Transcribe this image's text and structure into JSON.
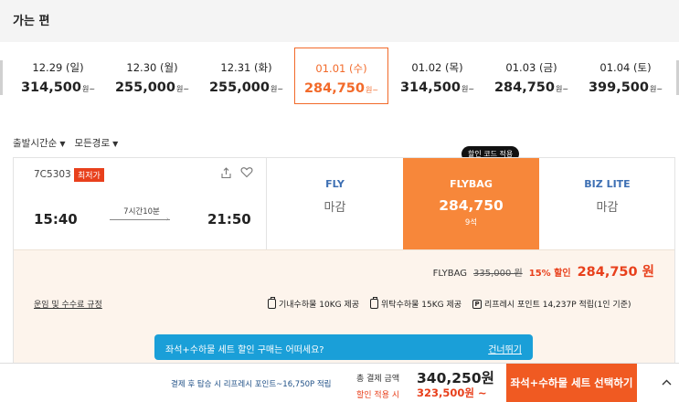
{
  "section": {
    "title": "가는 편"
  },
  "dates": [
    {
      "date": "12.29 (일)",
      "price": "314,500",
      "unit": "원~"
    },
    {
      "date": "12.30 (월)",
      "price": "255,000",
      "unit": "원~"
    },
    {
      "date": "12.31 (화)",
      "price": "255,000",
      "unit": "원~"
    },
    {
      "date": "01.01 (수)",
      "price": "284,750",
      "unit": "원~",
      "selected": true
    },
    {
      "date": "01.02 (목)",
      "price": "314,500",
      "unit": "원~"
    },
    {
      "date": "01.03 (금)",
      "price": "284,750",
      "unit": "원~"
    },
    {
      "date": "01.04 (토)",
      "price": "399,500",
      "unit": "원~"
    }
  ],
  "filters": {
    "sort": "출발시간순",
    "route": "모든경로"
  },
  "flight": {
    "number": "7C5303",
    "badge": "최저가",
    "departure": "15:40",
    "arrival": "21:50",
    "duration": "7시간10분"
  },
  "fares": {
    "fly": {
      "name": "FLY",
      "status": "마감"
    },
    "flybag": {
      "name": "FLYBAG",
      "price": "284,750",
      "seats": "9석"
    },
    "bizlite": {
      "name": "BIZ LITE",
      "status": "마감"
    }
  },
  "promo_bubble": "할인 코드 적용",
  "price_detail": {
    "fare_name": "FLYBAG",
    "original": "335,000 원",
    "discount": "15% 할인",
    "final": "284,750 원"
  },
  "rules_link": "운임 및 수수료 규정",
  "benefits": {
    "carry_on": "기내수하물 10KG 제공",
    "checked": "위탁수하물 15KG 제공",
    "points_icon": "P",
    "points": "리프레시 포인트 14,237P 적립(1인 기준)"
  },
  "banner": {
    "text": "좌석+수하물 세트 할인 구매는 어떠세요?",
    "skip": "건너뛰기"
  },
  "footer": {
    "note": "결제 후 탑승 시 리프레시 포인트~16,750P 적립",
    "total_label": "총 결제 금액",
    "total": "340,250원",
    "discount_label": "할인 적용 시",
    "discount_price": "323,500원 ~",
    "cta": "좌석+수하물 세트 선택하기",
    "collapse_icon": "chevron-up-icon"
  },
  "colors": {
    "accent": "#f26a2a",
    "fare_selected": "#f7873a",
    "banner": "#1a9fd8",
    "discount_red": "#e8401c"
  }
}
